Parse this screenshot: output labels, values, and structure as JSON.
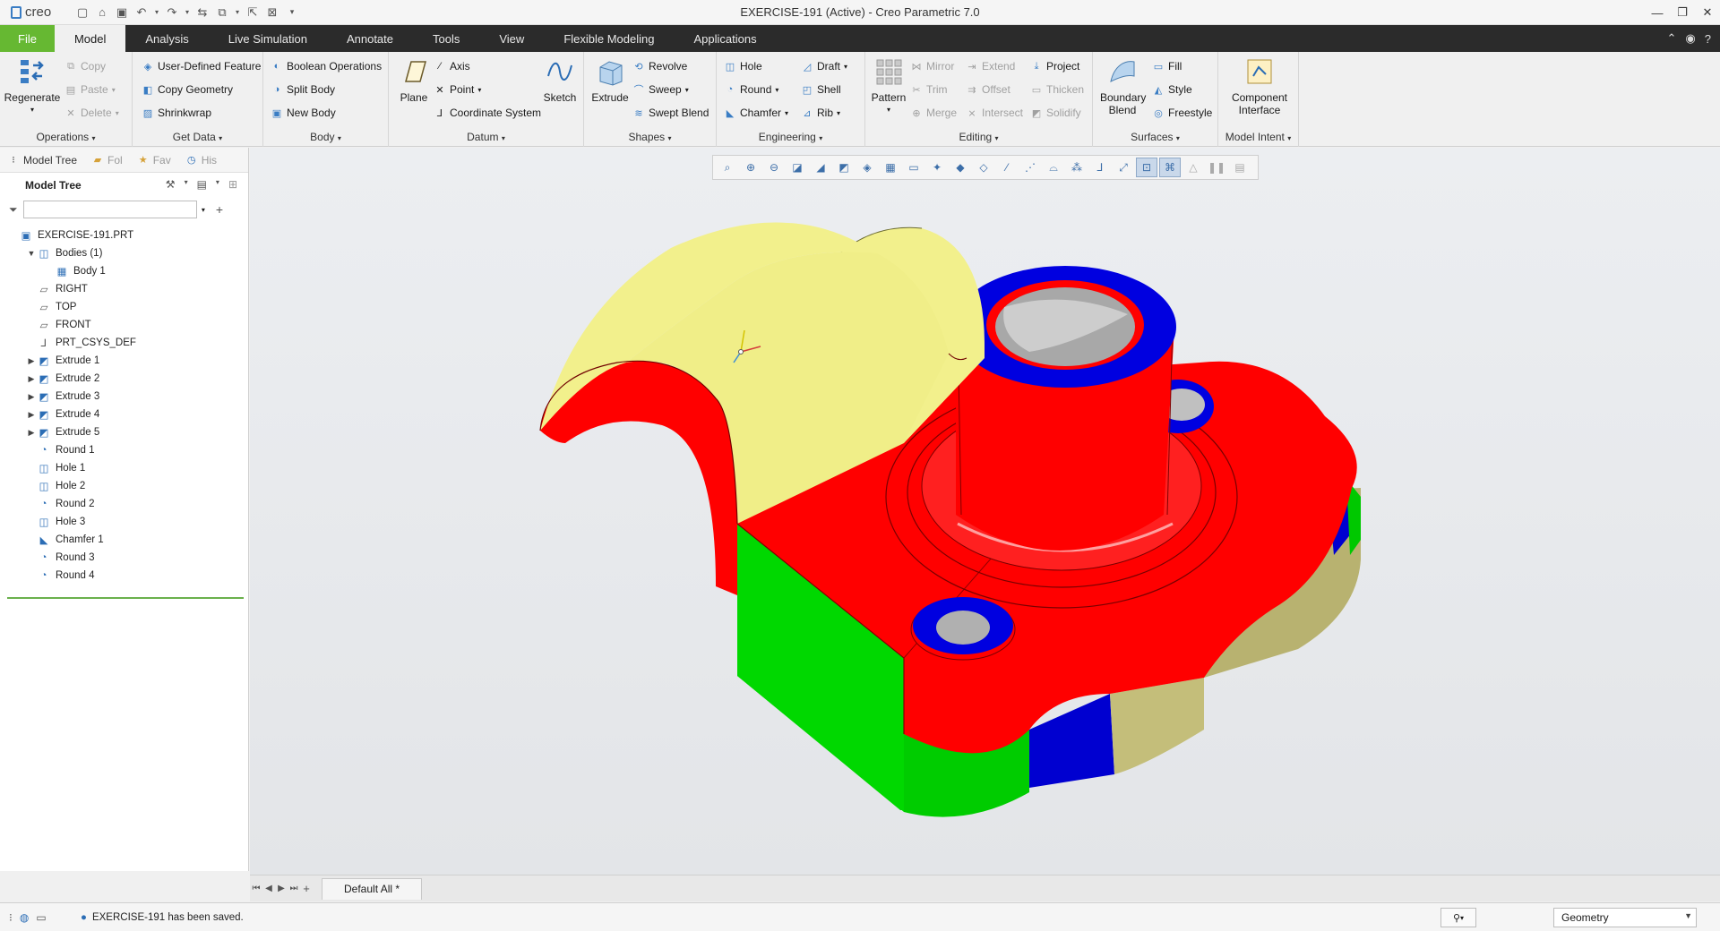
{
  "app": {
    "logo_text": "creo",
    "window_title": "EXERCISE-191 (Active) - Creo Parametric 7.0"
  },
  "menu": {
    "tabs": [
      "File",
      "Model",
      "Analysis",
      "Live Simulation",
      "Annotate",
      "Tools",
      "View",
      "Flexible Modeling",
      "Applications"
    ],
    "active": "Model"
  },
  "ribbon": {
    "operations": {
      "label": "Operations",
      "regenerate": "Regenerate",
      "copy": "Copy",
      "paste": "Paste",
      "delete": "Delete"
    },
    "get_data": {
      "label": "Get Data",
      "udf": "User-Defined Feature",
      "copy_geometry": "Copy Geometry",
      "shrinkwrap": "Shrinkwrap"
    },
    "body": {
      "label": "Body",
      "boolean": "Boolean Operations",
      "split": "Split Body",
      "new": "New Body"
    },
    "datum": {
      "label": "Datum",
      "plane": "Plane",
      "axis": "Axis",
      "point": "Point",
      "csys": "Coordinate System",
      "sketch": "Sketch"
    },
    "shapes": {
      "label": "Shapes",
      "extrude": "Extrude",
      "revolve": "Revolve",
      "sweep": "Sweep",
      "swept_blend": "Swept Blend"
    },
    "engineering": {
      "label": "Engineering",
      "hole": "Hole",
      "round": "Round",
      "chamfer": "Chamfer",
      "draft": "Draft",
      "shell": "Shell",
      "rib": "Rib"
    },
    "editing": {
      "label": "Editing",
      "pattern": "Pattern",
      "mirror": "Mirror",
      "trim": "Trim",
      "merge": "Merge",
      "extend": "Extend",
      "offset": "Offset",
      "intersect": "Intersect",
      "project": "Project",
      "thicken": "Thicken",
      "solidify": "Solidify"
    },
    "surfaces": {
      "label": "Surfaces",
      "boundary_blend": "Boundary Blend",
      "fill": "Fill",
      "style": "Style",
      "freestyle": "Freestyle"
    },
    "model_intent": {
      "label": "Model Intent",
      "component_interface": "Component Interface"
    }
  },
  "panel": {
    "tabs": [
      "Model Tree",
      "Fol",
      "Fav",
      "His"
    ],
    "tree_title": "Model Tree",
    "search_value": "",
    "items": [
      {
        "label": "EXERCISE-191.PRT",
        "level": 0,
        "expand": "",
        "icon": "part-icon"
      },
      {
        "label": "Bodies (1)",
        "level": 1,
        "expand": "▼",
        "icon": "bodies-icon"
      },
      {
        "label": "Body 1",
        "level": 2,
        "expand": "",
        "icon": "body-icon"
      },
      {
        "label": "RIGHT",
        "level": 1,
        "expand": "",
        "icon": "datum-plane-icon"
      },
      {
        "label": "TOP",
        "level": 1,
        "expand": "",
        "icon": "datum-plane-icon"
      },
      {
        "label": "FRONT",
        "level": 1,
        "expand": "",
        "icon": "datum-plane-icon"
      },
      {
        "label": "PRT_CSYS_DEF",
        "level": 1,
        "expand": "",
        "icon": "csys-icon"
      },
      {
        "label": "Extrude 1",
        "level": 1,
        "expand": "▶",
        "icon": "extrude-icon"
      },
      {
        "label": "Extrude 2",
        "level": 1,
        "expand": "▶",
        "icon": "extrude-icon"
      },
      {
        "label": "Extrude 3",
        "level": 1,
        "expand": "▶",
        "icon": "extrude-icon"
      },
      {
        "label": "Extrude 4",
        "level": 1,
        "expand": "▶",
        "icon": "extrude-icon"
      },
      {
        "label": "Extrude 5",
        "level": 1,
        "expand": "▶",
        "icon": "extrude-icon"
      },
      {
        "label": "Round 1",
        "level": 1,
        "expand": "",
        "icon": "round-icon"
      },
      {
        "label": "Hole 1",
        "level": 1,
        "expand": "",
        "icon": "hole-icon"
      },
      {
        "label": "Hole 2",
        "level": 1,
        "expand": "",
        "icon": "hole-icon"
      },
      {
        "label": "Round 2",
        "level": 1,
        "expand": "",
        "icon": "round-icon"
      },
      {
        "label": "Hole 3",
        "level": 1,
        "expand": "",
        "icon": "hole-icon"
      },
      {
        "label": "Chamfer 1",
        "level": 1,
        "expand": "",
        "icon": "chamfer-icon"
      },
      {
        "label": "Round 3",
        "level": 1,
        "expand": "",
        "icon": "round-icon"
      },
      {
        "label": "Round 4",
        "level": 1,
        "expand": "",
        "icon": "round-icon"
      }
    ]
  },
  "window_tab": {
    "label": "Default All *"
  },
  "status": {
    "message": "EXERCISE-191 has been saved.",
    "selection_filter": "Geometry"
  },
  "colors": {
    "file_tab": "#66b832",
    "menu_bar": "#2b2b2b",
    "model_red": "#ff0000",
    "model_blue": "#0000e0",
    "model_green": "#00d800",
    "model_yellow": "#f2f08c",
    "model_khaki": "#b8b270",
    "tree_end_line": "#6ab04c"
  }
}
